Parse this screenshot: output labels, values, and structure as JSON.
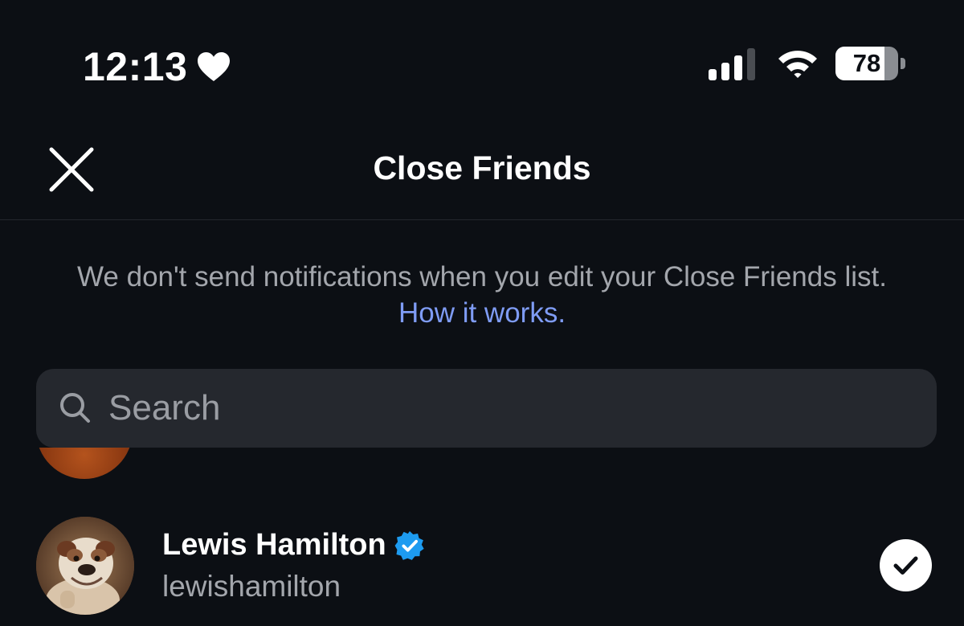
{
  "status_bar": {
    "time": "12:13",
    "heart_icon": "heart-icon",
    "battery_level": "78",
    "battery_fraction": 0.78
  },
  "header": {
    "title": "Close Friends",
    "close_icon": "close-icon"
  },
  "notice": {
    "text": "We don't send notifications when you edit your Close Friends list.",
    "link_text": "How it works."
  },
  "search": {
    "placeholder": "Search",
    "value": ""
  },
  "list": {
    "items": [
      {
        "name": "Lewis Hamilton",
        "handle": "lewishamilton",
        "verified": true,
        "selected": true
      }
    ]
  },
  "colors": {
    "background": "#0c0f14",
    "link": "#7f9cf5",
    "verified": "#1d9bf0",
    "secondary_text": "#a3a6ac",
    "search_bg": "#25282e"
  }
}
